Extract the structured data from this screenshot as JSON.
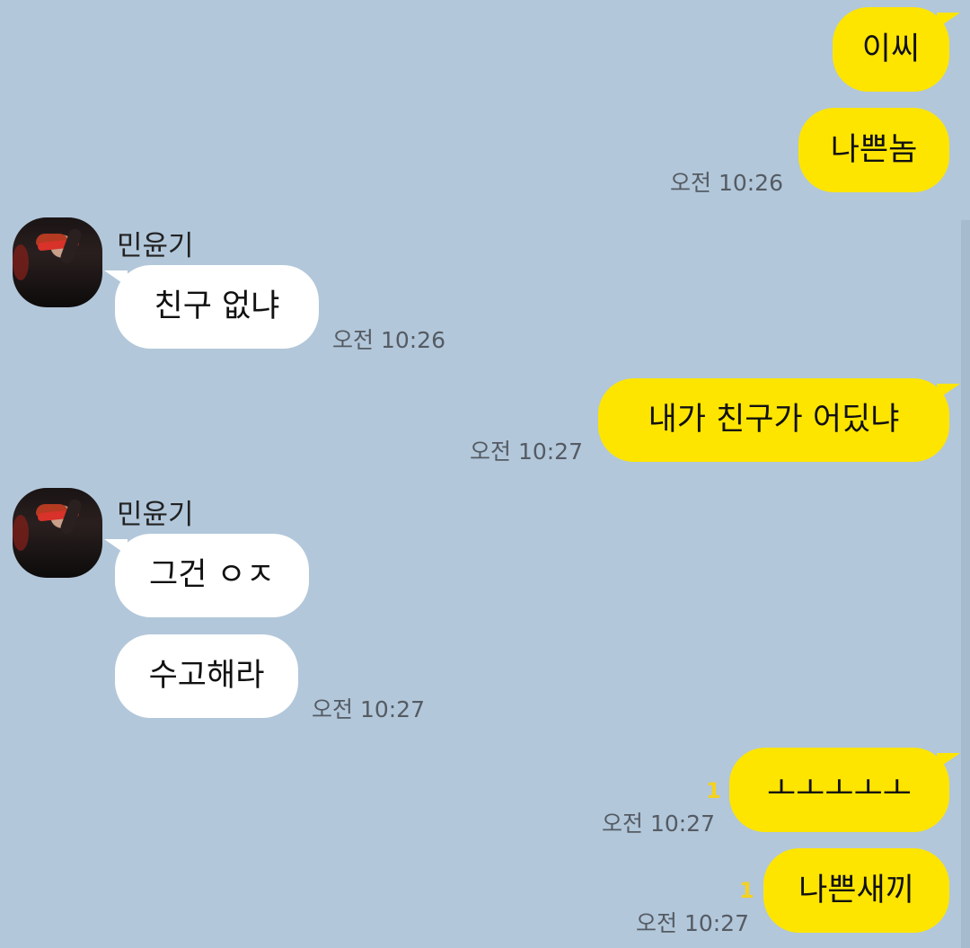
{
  "sender": {
    "name": "민윤기"
  },
  "messages": {
    "m1": {
      "text": "이씨"
    },
    "m2": {
      "text": "나쁜놈",
      "time": "오전 10:26"
    },
    "m3": {
      "text": "친구 없냐",
      "time": "오전 10:26"
    },
    "m4": {
      "text": "내가 친구가 어딨냐",
      "time": "오전 10:27"
    },
    "m5": {
      "text": "그건 ㅇㅈ"
    },
    "m6": {
      "text": "수고해라",
      "time": "오전 10:27"
    },
    "m7": {
      "text": "ㅗㅗㅗㅗㅗ",
      "time": "오전 10:27",
      "unread": "1"
    },
    "m8": {
      "text": "나쁜새끼",
      "time": "오전 10:27",
      "unread": "1"
    }
  },
  "colors": {
    "background": "#b2c7da",
    "my_bubble": "#fee500",
    "other_bubble": "#ffffff",
    "unread": "#f5d21e"
  }
}
